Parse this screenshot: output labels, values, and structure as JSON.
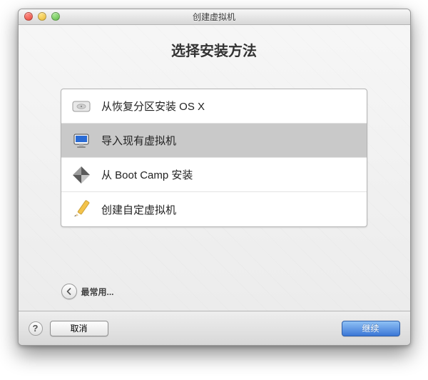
{
  "window": {
    "title": "创建虚拟机"
  },
  "heading": "选择安装方法",
  "options": [
    {
      "label": "从恢复分区安装 OS X"
    },
    {
      "label": "导入现有虚拟机"
    },
    {
      "label": "从 Boot Camp 安装"
    },
    {
      "label": "创建自定虚拟机"
    }
  ],
  "most_used": "最常用...",
  "footer": {
    "help": "?",
    "cancel": "取消",
    "continue": "继续"
  }
}
